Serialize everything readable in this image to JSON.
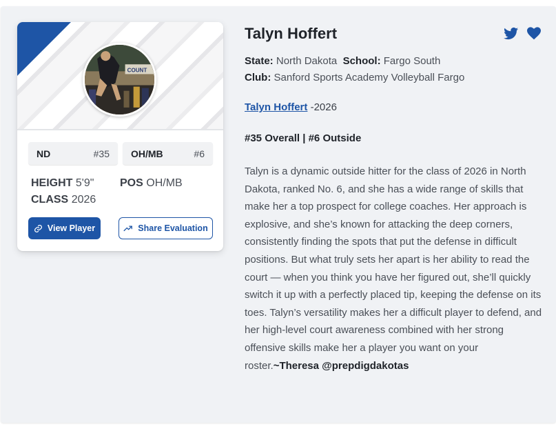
{
  "card": {
    "avatar_alt": "COUNT",
    "pills": [
      {
        "label": "ND",
        "value": "#35"
      },
      {
        "label": "OH/MB",
        "value": "#6"
      }
    ],
    "stats": {
      "height_label": "HEIGHT",
      "height_value": "5'9\"",
      "pos_label": "POS",
      "pos_value": "OH/MB",
      "class_label": "CLASS",
      "class_value": "2026"
    },
    "buttons": {
      "view_label": "View Player",
      "share_label": "Share Evaluation"
    }
  },
  "player": {
    "name": "Talyn Hoffert",
    "state_label": "State:",
    "state_value": "North Dakota",
    "school_label": "School:",
    "school_value": "Fargo South",
    "club_label": "Club:",
    "club_value": "Sanford Sports Academy Volleyball Fargo",
    "link_text": "Talyn Hoffert",
    "link_suffix": "-2026",
    "rank": "#35 Overall | #6 Outside",
    "bio": "Talyn is a dynamic outside hitter for the class of 2026 in North Dakota, ranked No. 6, and she has a wide range of skills that make her a top prospect for college coaches. Her approach is explosive, and she’s known for attacking the deep corners, consistently finding the spots that put the defense in difficult positions. But what truly sets her apart is her ability to read the court — when you think you have her figured out, she’ll quickly switch it up with a perfectly placed tip, keeping the defense on its toes. Talyn’s versatility makes her a difficult player to defend, and her high-level court awareness combined with her strong offensive skills make her a player you want on your roster.",
    "signature": "~Theresa @prepdigdakotas"
  },
  "icons": {
    "twitter": "twitter-icon",
    "favorite": "heart-icon",
    "link": "link-icon",
    "trend": "trend-up-icon"
  },
  "colors": {
    "accent": "#1e55a6",
    "panel_bg": "#f0f2f5"
  }
}
